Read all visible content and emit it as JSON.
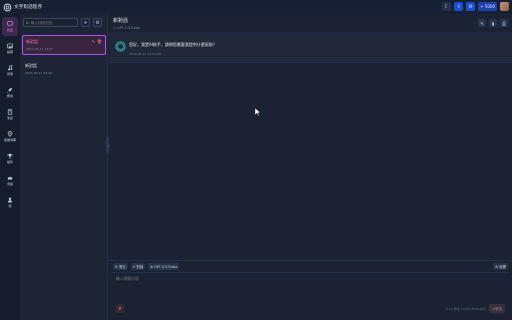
{
  "app": {
    "title": "文字對話程序",
    "logo_icon": "openai-logo-icon"
  },
  "topbar": {
    "theme_icon": "moon-icon",
    "button2_icon": "share-icon",
    "button3_icon": "settings-icon",
    "pill_label": "+ 5000",
    "colors": {
      "pill": "#1e40af"
    }
  },
  "rail": {
    "items": [
      {
        "label": "對話",
        "icon": "chat-icon",
        "active": true
      },
      {
        "label": "繪圖",
        "icon": "image-icon"
      },
      {
        "label": "音樂",
        "icon": "music-icon"
      },
      {
        "label": "應用",
        "icon": "rocket-icon"
      },
      {
        "label": "筆記",
        "icon": "book-icon"
      },
      {
        "label": "思維導圖",
        "icon": "location-icon"
      },
      {
        "label": "插件",
        "icon": "trophy-icon"
      },
      {
        "label": "會員",
        "icon": "crown-icon"
      },
      {
        "label": "我",
        "icon": "user-icon"
      }
    ]
  },
  "sidebar": {
    "search_placeholder": "輸入搜索對話",
    "add_label": "+",
    "conversations": [
      {
        "title": "新對話",
        "time": "2024-06-11 14:07"
      },
      {
        "title": "新對話",
        "time": "2024-06-11 09:46"
      }
    ]
  },
  "chat": {
    "title": "新對話",
    "model": "GPT-3.5-Turbo",
    "message_text": "您好，我是AI助手，請問您需要我提供什麼幫助？",
    "message_time": "2024-06-11 14:07:48"
  },
  "composer": {
    "tools": [
      {
        "label": "清空",
        "icon": "trash-icon"
      },
      {
        "label": "對話",
        "icon": "chat-small-icon"
      },
      {
        "label": "GPT-3.5-Turbo",
        "icon": "model-icon"
      }
    ],
    "right_tool": "設置",
    "placeholder": "輸入問題內容",
    "hint": "Enter發送 | Shift+Enter換行",
    "send_label": "發送",
    "colors": {
      "accent": "#a855f7",
      "danger": "#f87171"
    }
  }
}
